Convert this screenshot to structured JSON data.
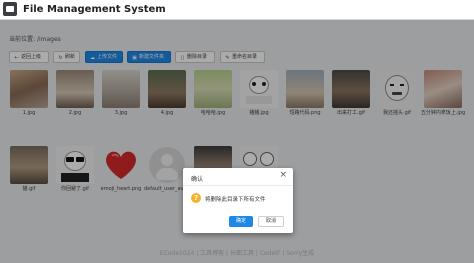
{
  "app": {
    "title": "File Management System"
  },
  "breadcrumb": {
    "label": "当前位置:",
    "path": "/images"
  },
  "toolbar": {
    "back": "返回上级",
    "refresh": "刷新",
    "upload": "上传文件",
    "new_folder": "新建文件夹",
    "delete_dir": "删除目录",
    "rename_dir": "重命名目录"
  },
  "files_row1": [
    {
      "name": "1.jpg",
      "icon": "photo-people"
    },
    {
      "name": "2.jpg",
      "icon": "photo-food"
    },
    {
      "name": "3.jpg",
      "icon": "photo-room"
    },
    {
      "name": "4.jpg",
      "icon": "photo-outdoor"
    },
    {
      "name": "哈哈哈.jpg",
      "icon": "photo-green"
    },
    {
      "name": "猪猪.jpg",
      "icon": "meme-panda"
    },
    {
      "name": "短路代码.png",
      "icon": "meme-cartoon"
    },
    {
      "name": "出来打工.gif",
      "icon": "photo-actor"
    },
    {
      "name": "我还摇头.gif",
      "icon": "meme-face"
    },
    {
      "name": "五分钟内拿饭上.jpg",
      "icon": "photo-crowd"
    }
  ],
  "files_row2": [
    {
      "name": "猫.gif",
      "icon": "photo-cat"
    },
    {
      "name": "你回避了.gif",
      "icon": "meme-panda-glasses"
    },
    {
      "name": "emoji_heart.png",
      "icon": "heart"
    },
    {
      "name": "default_user_avatar.png",
      "icon": "default-avatar"
    },
    {
      "name": "",
      "icon": "photo-man"
    },
    {
      "name": "",
      "icon": "meme-faces"
    }
  ],
  "footer": {
    "text": "ECode1024 | 工具博客 | 长图工具 | CodeIF | Sorry生成"
  },
  "dialog": {
    "title": "确认",
    "message": "将删除此目录下所有文件",
    "ok": "确定",
    "cancel": "取消",
    "close_glyph": "×",
    "warn_glyph": "?"
  },
  "colors": {
    "primary": "#1e88e5",
    "warning": "#f6b12d",
    "heart": "#d62a2a"
  }
}
